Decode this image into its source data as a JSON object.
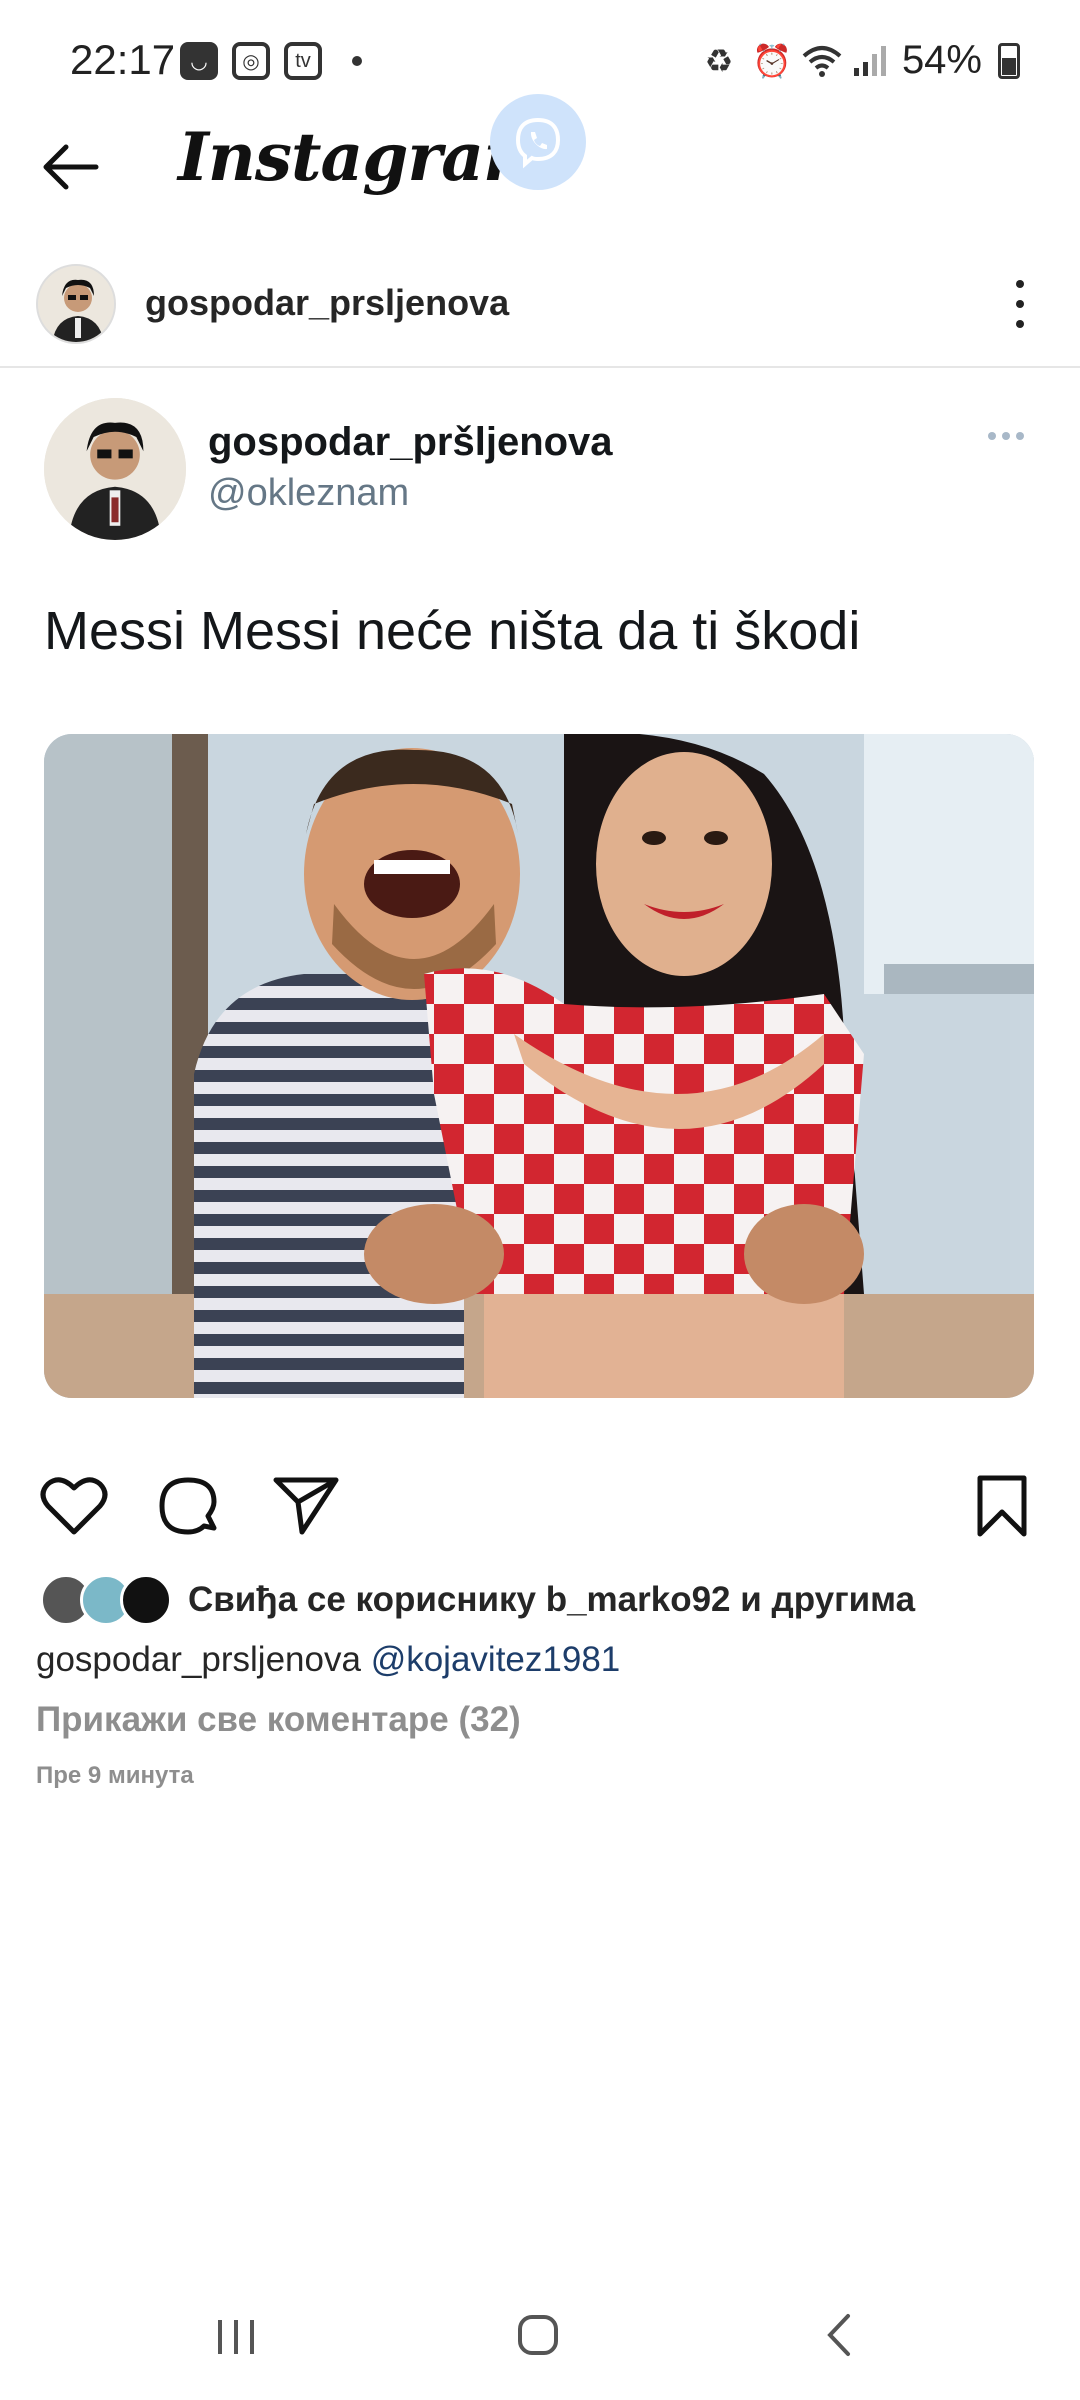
{
  "status_bar": {
    "time": "22:17",
    "battery": "54%"
  },
  "app_bar": {
    "title": "Instagram"
  },
  "post": {
    "username": "gospodar_prsljenova",
    "tweet": {
      "display_name": "gospodar_pršljenova",
      "handle": "@okleznam",
      "text": "Messi Messi neće ništa da ti škodi"
    },
    "likes_text": "Свиђа се кориснику b_marko92 и другима",
    "caption_username": "gospodar_prsljenova",
    "caption_mention": "@kojavitez1981",
    "view_comments": "Прикажи све коментаре (32)",
    "time_ago": "Пре 9 минута"
  },
  "icons": {
    "back": "back-arrow-icon",
    "viber": "viber-icon",
    "more": "more-vertical-icon",
    "like": "heart-icon",
    "comment": "comment-icon",
    "share": "send-icon",
    "save": "bookmark-icon"
  },
  "colors": {
    "accent_link": "#1d3d6a",
    "handle": "#657786",
    "secondary": "#8e8e8e"
  }
}
